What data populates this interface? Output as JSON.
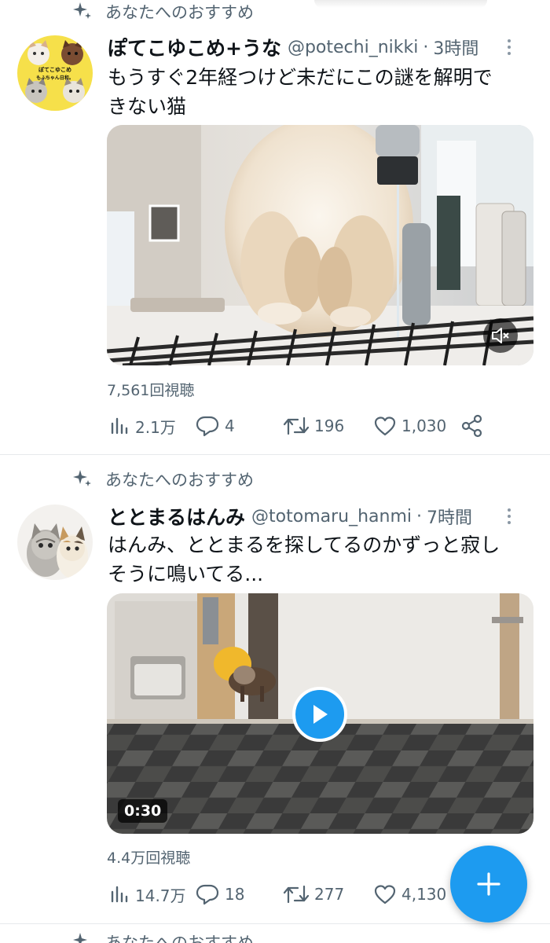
{
  "feed": {
    "tweets": [
      {
        "context": "あなたへのおすすめ",
        "name": "ぽてこゆこめ+うな",
        "handle": "@potechi_nikki",
        "dot": "·",
        "time": "3時間",
        "text_line1": "もうすぐ2年経つけど未だにこの謎を解明で",
        "text_line2": "きない猫",
        "avatar_caption_1": "ぽてこゆこめ",
        "avatar_caption_2": "もふちゃん日和。",
        "views": "7,561回視聴",
        "stats": {
          "impressions": "2.1万",
          "replies": "4",
          "retweets": "196",
          "likes": "1,030"
        },
        "media": {
          "type": "video",
          "muted": true
        }
      },
      {
        "context": "あなたへのおすすめ",
        "name": "ととまるはんみ",
        "handle": "@totomaru_hanmi",
        "dot": "·",
        "time": "7時間",
        "text_line1": "はんみ、ととまるを探してるのかずっと寂し",
        "text_line2": "そうに鳴いてる...",
        "views": "4.4万回視聴",
        "stats": {
          "impressions": "14.7万",
          "replies": "18",
          "retweets": "277",
          "likes": "4,130"
        },
        "media": {
          "type": "video",
          "duration": "0:30"
        }
      }
    ],
    "next_context": "あなたへのおすすめ"
  },
  "colors": {
    "accent": "#1d9bf0",
    "text_primary": "#0f1419",
    "text_secondary": "#536471",
    "divider": "#e6e9ec"
  },
  "icons": [
    "sparkle-icon",
    "more-icon",
    "impressions-icon",
    "reply-icon",
    "retweet-icon",
    "like-icon",
    "share-icon",
    "mute-icon",
    "play-icon",
    "compose-icon"
  ]
}
